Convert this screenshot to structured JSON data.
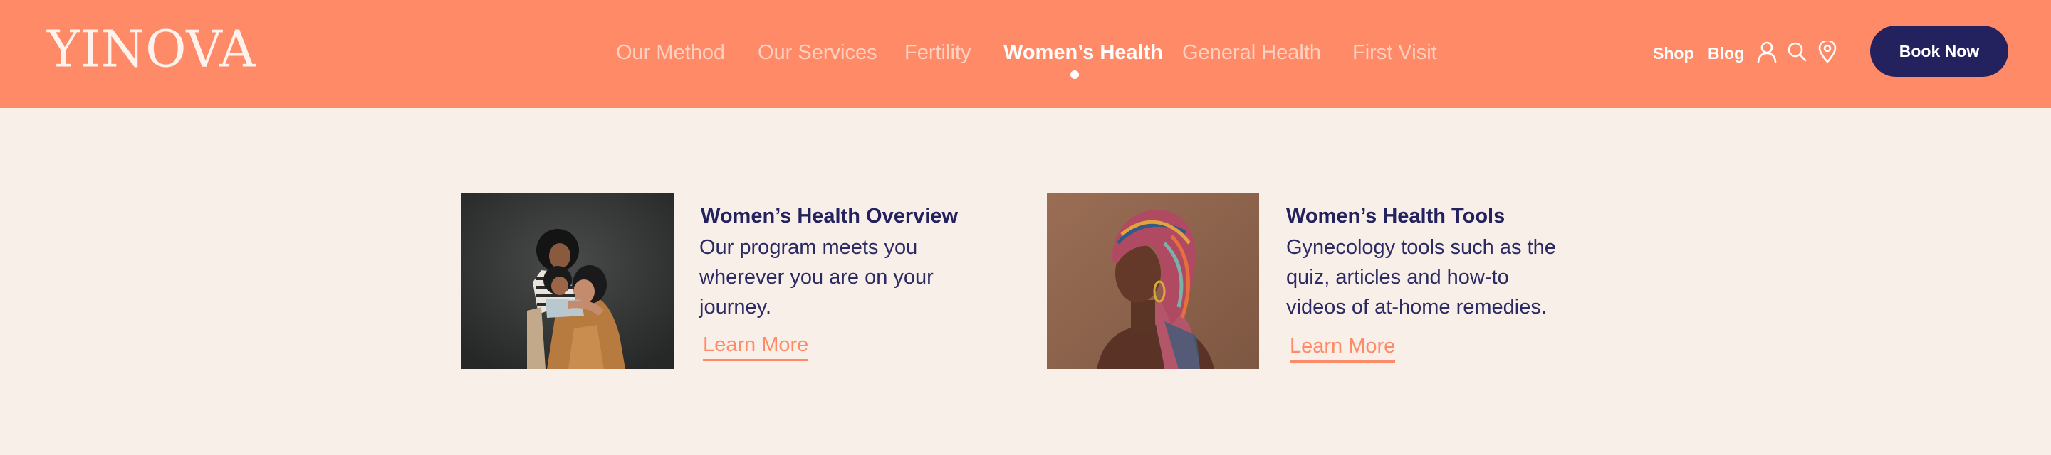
{
  "header": {
    "logo": "YINOVA",
    "nav": [
      {
        "label": "Our Method",
        "active": false
      },
      {
        "label": "Our Services",
        "active": false
      },
      {
        "label": "Fertility",
        "active": false
      },
      {
        "label": "Women’s Health",
        "active": true
      },
      {
        "label": "General Health",
        "active": false
      },
      {
        "label": "First Visit",
        "active": false
      }
    ],
    "utility": {
      "shop": "Shop",
      "blog": "Blog"
    },
    "icons": [
      "user-icon",
      "search-icon",
      "location-pin-icon"
    ],
    "book_button": "Book Now"
  },
  "cards": [
    {
      "title": "Women’s Health Overview",
      "body": "Our program meets you wherever you are on your journey.",
      "link": "Learn More",
      "image": "mother-hugging-two-children-photo"
    },
    {
      "title": "Women’s Health Tools",
      "body": "Gynecology tools such as the quiz, articles and how-to videos of at-home remedies.",
      "link": "Learn More",
      "image": "woman-in-patterned-headwrap-photo"
    }
  ],
  "colors": {
    "header_bg": "#ff8a68",
    "page_bg": "#f9efe9",
    "navy": "#23225f",
    "accent": "#ff8a68"
  }
}
